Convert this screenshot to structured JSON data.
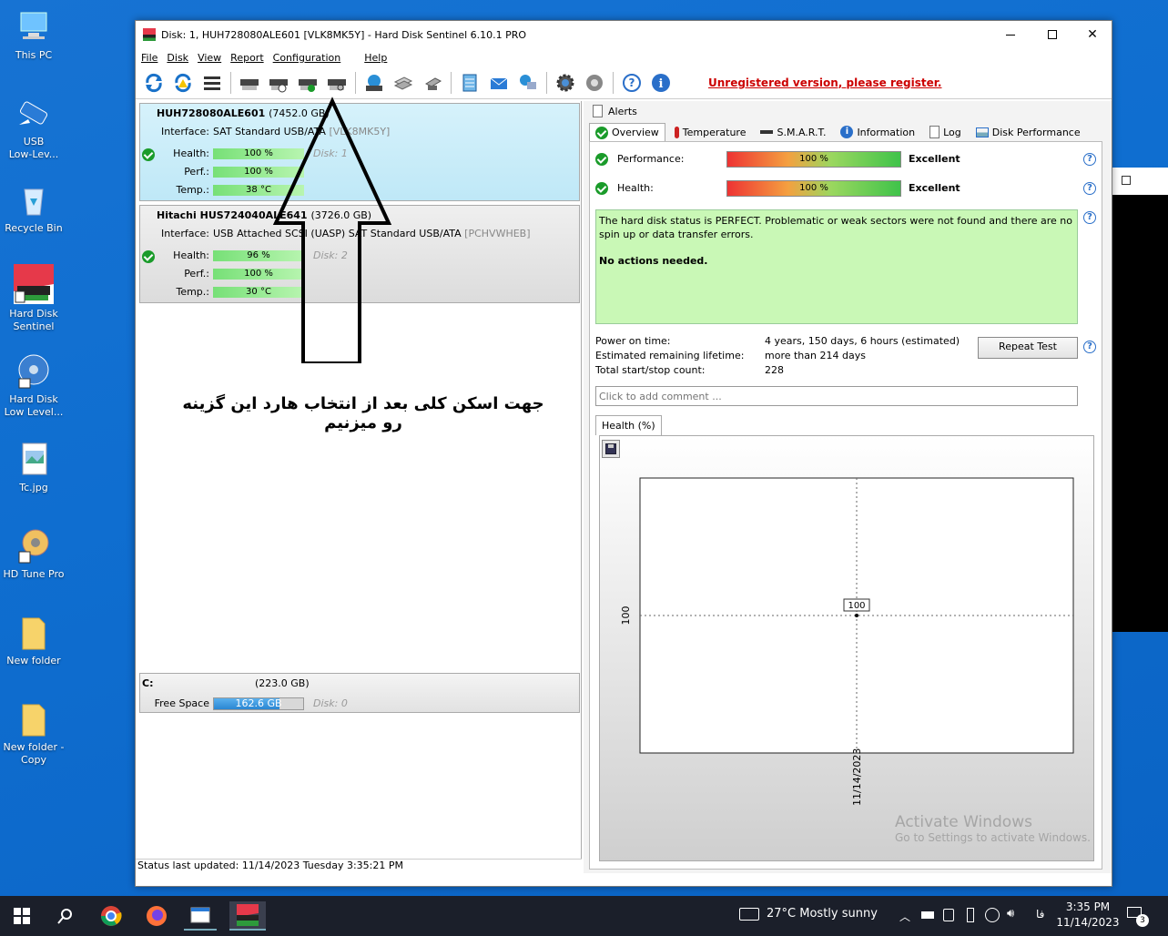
{
  "desktop": {
    "icons": [
      {
        "label": "This PC"
      },
      {
        "label": "USB\nLow-Lev..."
      },
      {
        "label": "Recycle Bin"
      },
      {
        "label": "Hard Disk\nSentinel"
      },
      {
        "label": "Hard Disk\nLow Level..."
      },
      {
        "label": "Tc.jpg"
      },
      {
        "label": "HD Tune Pro"
      },
      {
        "label": "New folder"
      },
      {
        "label": "New folder -\nCopy"
      }
    ]
  },
  "window": {
    "title": "Disk: 1, HUH728080ALE601 [VLK8MK5Y]  -  Hard Disk Sentinel 6.10.1 PRO",
    "menu": [
      "File",
      "Disk",
      "View",
      "Report",
      "Configuration",
      "Help"
    ],
    "unregistered": "Unregistered version, please register."
  },
  "disks": [
    {
      "name": "HUH728080ALE601",
      "size": "(7452.0 GB)",
      "interface_label": "Interface:",
      "interface": "SAT Standard USB/ATA",
      "serial": "[VLK8MK5Y]",
      "health": "100 %",
      "perf": "100 %",
      "temp": "38 °C",
      "disk": "Disk: 1"
    },
    {
      "name": "Hitachi HUS724040ALE641",
      "size": "(3726.0 GB)",
      "interface_label": "Interface:",
      "interface": "USB Attached SCSI (UASP) SAT Standard USB/ATA",
      "serial": "[PCHVWHEB]",
      "health": "96 %",
      "perf": "100 %",
      "temp": "30 °C",
      "disk": "Disk: 2"
    }
  ],
  "labels": {
    "health": "Health:",
    "perf": "Perf.:",
    "temp": "Temp.:"
  },
  "volume": {
    "letter": "C:",
    "size": "(223.0 GB)",
    "free_label": "Free Space",
    "free": "162.6 GB",
    "disk": "Disk: 0",
    "free_fraction": 0.73
  },
  "annotation": "جهت اسکن کلی  بعد از انتخاب هارد این گزینه رو میزنیم",
  "status_bar": "Status last updated: 11/14/2023 Tuesday 3:35:21 PM",
  "tabs": {
    "alerts": "Alerts",
    "items": [
      "Overview",
      "Temperature",
      "S.M.A.R.T.",
      "Information",
      "Log",
      "Disk Performance"
    ]
  },
  "overview": {
    "performance_label": "Performance:",
    "performance_value": "100 %",
    "performance_rating": "Excellent",
    "health_label": "Health:",
    "health_value": "100 %",
    "health_rating": "Excellent",
    "status_text": "The hard disk status is PERFECT. Problematic or weak sectors were not found and there are no spin up or data transfer errors.",
    "action_text": "No actions needed.",
    "power_on_label": "Power on time:",
    "power_on_value": "4 years, 150 days, 6 hours (estimated)",
    "lifetime_label": "Estimated remaining lifetime:",
    "lifetime_value": "more than 214 days",
    "startstop_label": "Total start/stop count:",
    "startstop_value": "228",
    "repeat_test": "Repeat Test",
    "comment_placeholder": "Click to add comment ...",
    "chart_tab": "Health (%)"
  },
  "chart_data": {
    "type": "line",
    "x": [
      "11/14/2023"
    ],
    "series": [
      {
        "values": [
          100
        ]
      }
    ],
    "title": "",
    "xlabel": "",
    "ylabel": "",
    "y_tick_labels": [
      "100"
    ],
    "x_tick_labels": [
      "11/14/2023"
    ],
    "data_labels": [
      "100"
    ],
    "grid": true
  },
  "watermark": {
    "line1": "Activate Windows",
    "line2": "Go to Settings to activate Windows."
  },
  "taskbar": {
    "weather": "27°C  Mostly sunny",
    "time": "3:35 PM",
    "date": "11/14/2023",
    "lang": "فا",
    "notifications": "3"
  }
}
